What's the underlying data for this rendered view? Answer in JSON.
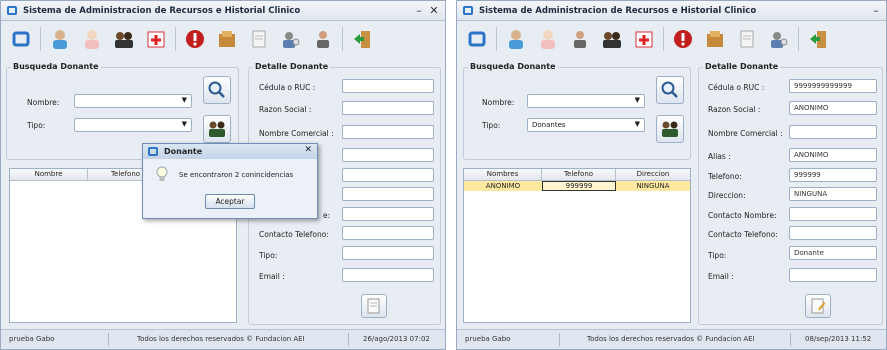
{
  "window_title": "Sistema de Administracion de Recursos e Historial Clinico",
  "toolbar_icons": [
    "home-icon",
    "patients-icon",
    "doctor-icon",
    "donors-icon",
    "first-aid-icon",
    "alert-icon",
    "inventory-icon",
    "report-icon",
    "users-icon",
    "user-icon",
    "exit-icon"
  ],
  "search_group": {
    "legend": "Busqueda Donante",
    "nombre_label": "Nombre:",
    "tipo_label": "Tipo:"
  },
  "left": {
    "nombre_value": "",
    "tipo_value": "",
    "list_columns": [
      "Nombre",
      "Telefono"
    ],
    "detail_fields": [
      {
        "label": "Cédula o RUC :",
        "value": ""
      },
      {
        "label": "Razon Social :",
        "value": ""
      },
      {
        "label": "Nombre Comercial :",
        "value": ""
      },
      {
        "label": "",
        "value": ""
      },
      {
        "label": "",
        "value": ""
      },
      {
        "label": "",
        "value": ""
      },
      {
        "label": "e:",
        "value": ""
      },
      {
        "label": "Contacto Telefono:",
        "value": ""
      },
      {
        "label": "Tipo:",
        "value": ""
      },
      {
        "label": "Email :",
        "value": ""
      }
    ],
    "status": {
      "user": "prueba Gabo",
      "rights": "Todos los derechos reservados © Fundacion AEI",
      "datetime": "26/ago/2013 07:02"
    }
  },
  "dialog": {
    "title": "Donante",
    "message": "Se encontraron 2 conincidencias",
    "ok_label": "Aceptar"
  },
  "right": {
    "nombre_value": "",
    "tipo_value": "Donantes",
    "list_columns": [
      "Nombres",
      "Telefono",
      "Direccion"
    ],
    "list_rows": [
      [
        "ANONIMO",
        "999999",
        "NINGUNA"
      ]
    ],
    "detail_fields": [
      {
        "label": "Cédula o RUC :",
        "value": "9999999999999"
      },
      {
        "label": "Razon Social :",
        "value": "ANONIMO"
      },
      {
        "label": "Nombre Comercial :",
        "value": ""
      },
      {
        "label": "Alias :",
        "value": "ANONIMO"
      },
      {
        "label": "Telefono:",
        "value": "999999"
      },
      {
        "label": "Direccion:",
        "value": "NINGUNA"
      },
      {
        "label": "Contacto Nombre:",
        "value": ""
      },
      {
        "label": "Contacto Telefono:",
        "value": ""
      },
      {
        "label": "Tipo:",
        "value": "Donante"
      },
      {
        "label": "Email :",
        "value": ""
      }
    ],
    "status": {
      "user": "prueba Gabo",
      "rights": "Todos los derechos reservados © Fundacion AEI",
      "datetime": "08/sep/2013 11:52"
    }
  },
  "detail_legend": "Detalle Donante",
  "colors": {
    "accent": "#2a74c8",
    "selected_row": "#ffe8a0",
    "window_bg": "#e8edf3"
  }
}
